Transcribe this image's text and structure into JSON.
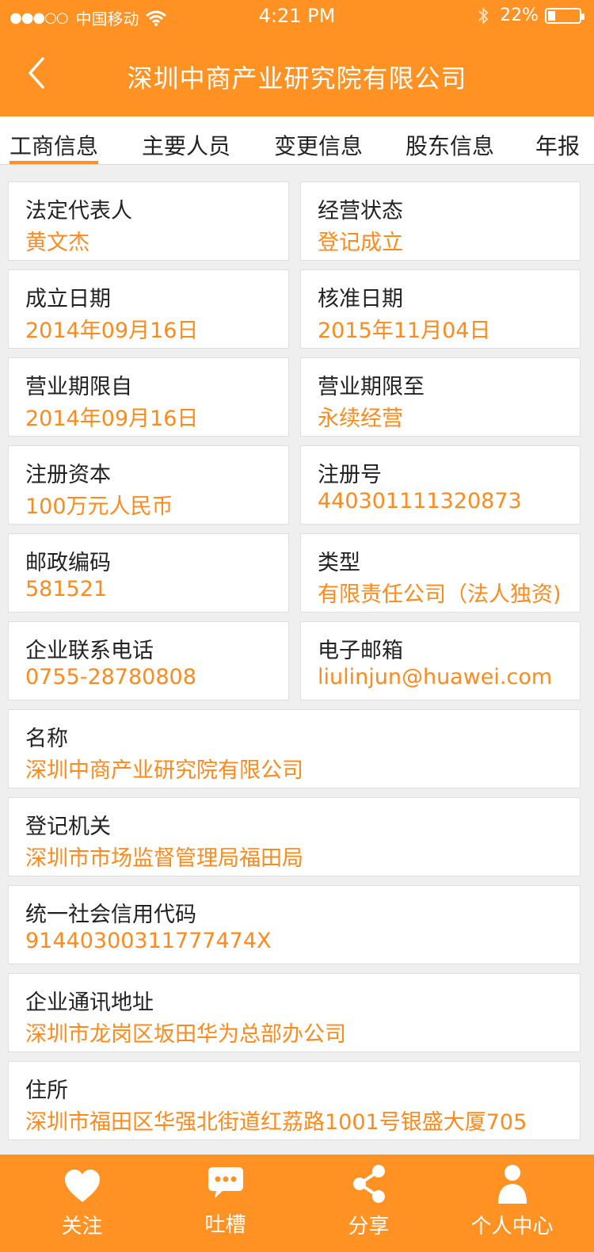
{
  "status_bar": {
    "signal": "●●●○○",
    "carrier": "中国移动",
    "time": "4:21 PM",
    "battery_pct": "22%",
    "bluetooth": "bluetooth-icon",
    "wifi": "wifi-icon",
    "battery_level": 0.22
  },
  "header": {
    "title": "深圳中商产业研究院有限公司",
    "back_icon": "chevron-left-icon"
  },
  "tabs": [
    {
      "label": "工商信息",
      "active": true
    },
    {
      "label": "主要人员",
      "active": false
    },
    {
      "label": "变更信息",
      "active": false
    },
    {
      "label": "股东信息",
      "active": false
    },
    {
      "label": "年报",
      "active": false
    }
  ],
  "fields": [
    {
      "label": "法定代表人",
      "value": "黄文杰"
    },
    {
      "label": "经营状态",
      "value": "登记成立"
    },
    {
      "label": "成立日期",
      "value": "2014年09月16日"
    },
    {
      "label": "核准日期",
      "value": "2015年11月04日"
    },
    {
      "label": "营业期限自",
      "value": "2014年09月16日"
    },
    {
      "label": "营业期限至",
      "value": "永续经营"
    },
    {
      "label": "注册资本",
      "value": "100万元人民币"
    },
    {
      "label": "注册号",
      "value": "440301111320873"
    },
    {
      "label": "邮政编码",
      "value": "581521"
    },
    {
      "label": "类型",
      "value": "有限责任公司（法人独资)"
    },
    {
      "label": "企业联系电话",
      "value": "0755-28780808"
    },
    {
      "label": "电子邮箱",
      "value": "liulinjun@huawei.com"
    },
    {
      "label": "名称",
      "value": "深圳中商产业研究院有限公司"
    },
    {
      "label": "登记机关",
      "value": "深圳市市场监督管理局福田局"
    },
    {
      "label": "统一社会信用代码",
      "value": "91440300311777474X"
    },
    {
      "label": "企业通讯地址",
      "value": "深圳市龙岗区坂田华为总部办公司"
    },
    {
      "label": "住所",
      "value": "深圳市福田区华强北街道红荔路1001号银盛大厦705"
    }
  ],
  "bottom_nav": [
    {
      "label": "关注",
      "icon": "heart-icon"
    },
    {
      "label": "吐槽",
      "icon": "chat-bubble-icon"
    },
    {
      "label": "分享",
      "icon": "share-icon"
    },
    {
      "label": "个人中心",
      "icon": "person-icon"
    }
  ],
  "colors": {
    "accent": "#ff9223",
    "value_text": "#ff8a1c",
    "background": "#efefef"
  }
}
